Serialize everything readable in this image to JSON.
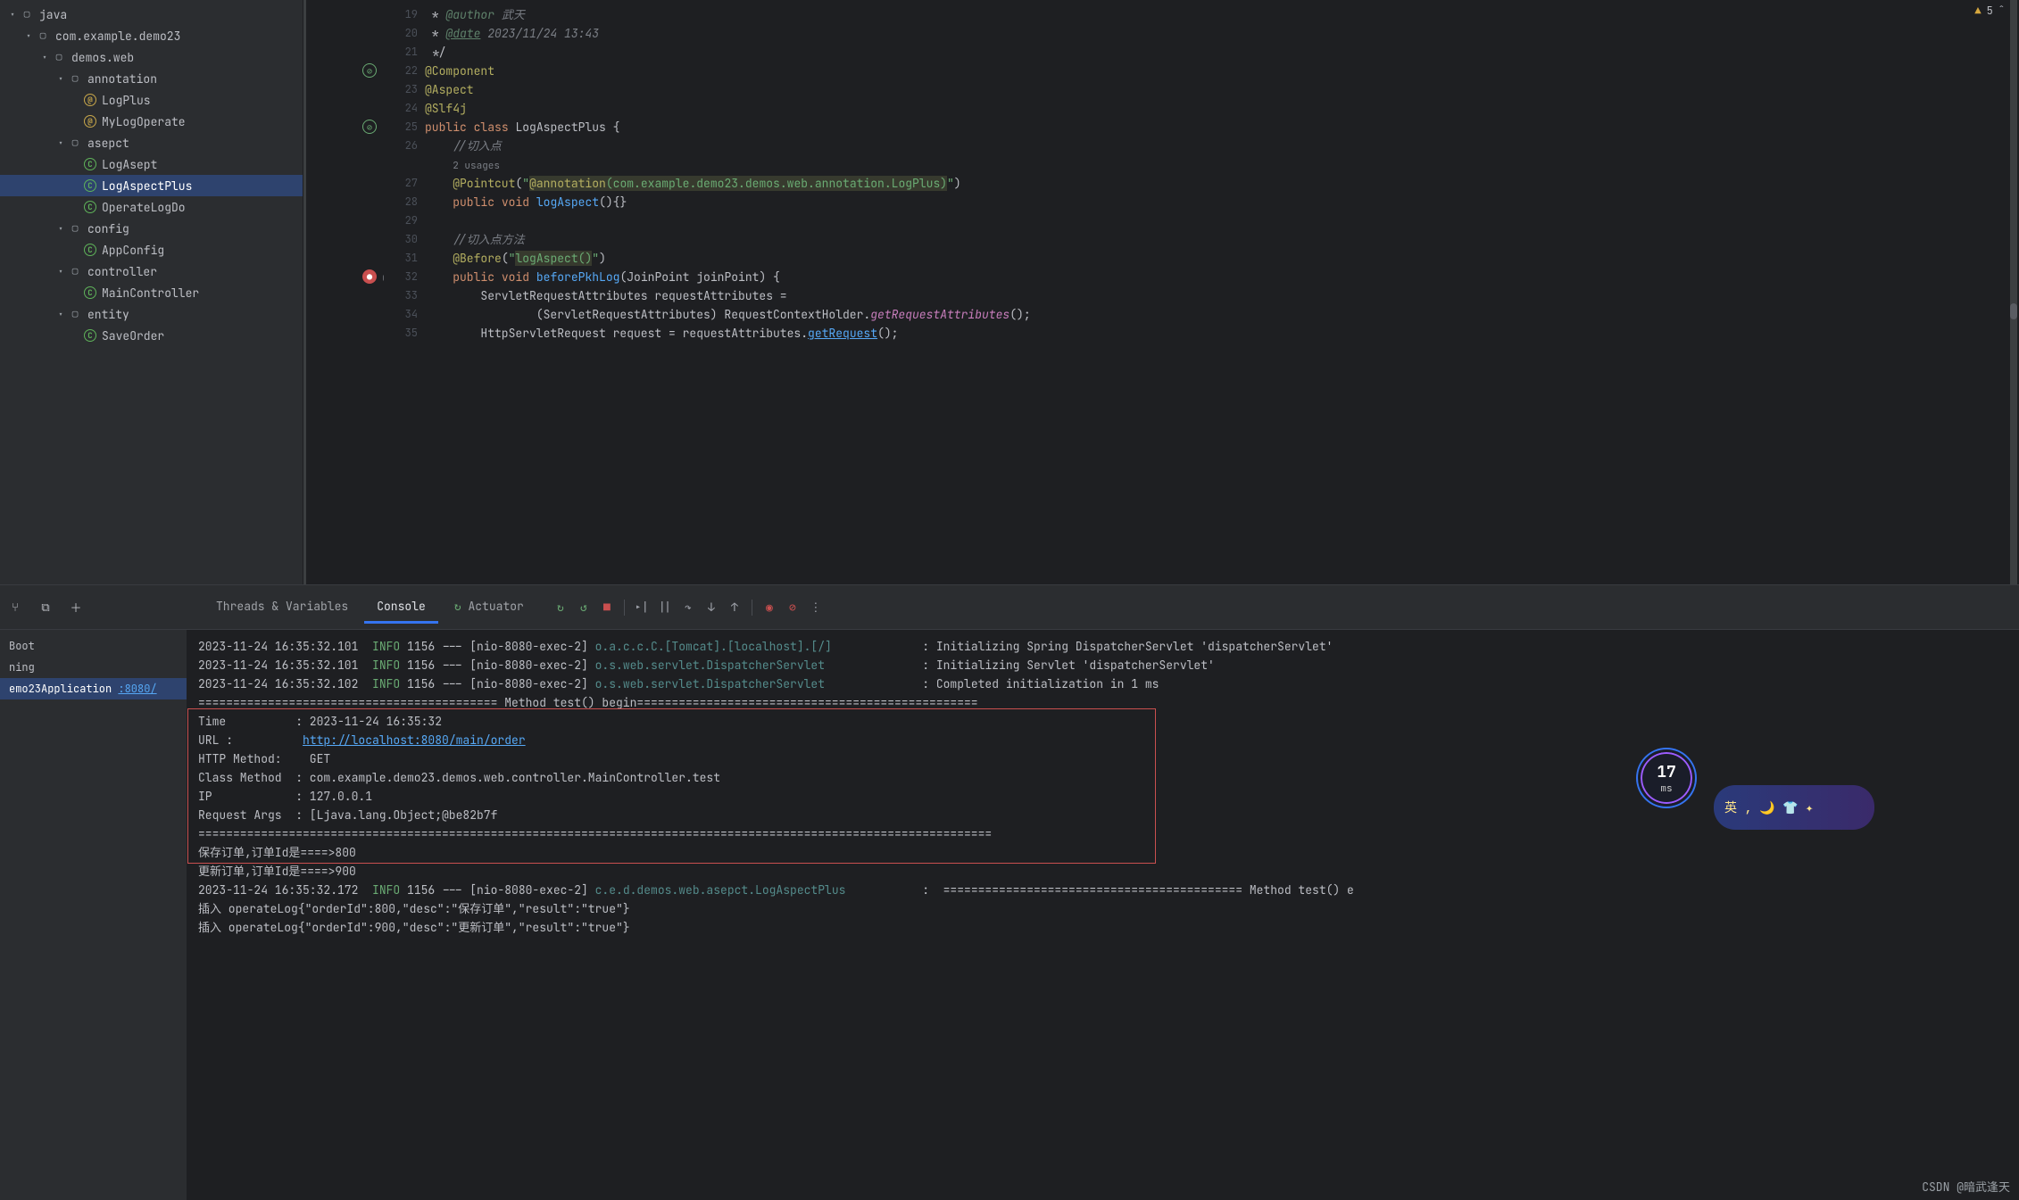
{
  "inspection": {
    "warn_count": "5"
  },
  "tree": [
    {
      "d": 0,
      "tw": "▾",
      "ic": "dir",
      "label": "java"
    },
    {
      "d": 1,
      "tw": "▾",
      "ic": "dir",
      "label": "com.example.demo23"
    },
    {
      "d": 2,
      "tw": "▾",
      "ic": "dir",
      "label": "demos.web"
    },
    {
      "d": 3,
      "tw": "▾",
      "ic": "dir",
      "label": "annotation"
    },
    {
      "d": 4,
      "tw": "",
      "ic": "ann",
      "label": "LogPlus"
    },
    {
      "d": 4,
      "tw": "",
      "ic": "ann",
      "label": "MyLogOperate"
    },
    {
      "d": 3,
      "tw": "▾",
      "ic": "dir",
      "label": "asepct"
    },
    {
      "d": 4,
      "tw": "",
      "ic": "cls",
      "label": "LogAsept"
    },
    {
      "d": 4,
      "tw": "",
      "ic": "cls",
      "label": "LogAspectPlus",
      "sel": true
    },
    {
      "d": 4,
      "tw": "",
      "ic": "cls",
      "label": "OperateLogDo"
    },
    {
      "d": 3,
      "tw": "▾",
      "ic": "dir",
      "label": "config"
    },
    {
      "d": 4,
      "tw": "",
      "ic": "cls",
      "label": "AppConfig"
    },
    {
      "d": 3,
      "tw": "▾",
      "ic": "dir",
      "label": "controller"
    },
    {
      "d": 4,
      "tw": "",
      "ic": "cls",
      "label": "MainController"
    },
    {
      "d": 3,
      "tw": "▾",
      "ic": "dir",
      "label": "entity"
    },
    {
      "d": 4,
      "tw": "",
      "ic": "cls",
      "label": "SaveOrder"
    }
  ],
  "code": {
    "start": 19,
    "lines": [
      {
        "h": " * <span class='c-doc'>@author</span> <span class='c-com'>武天</span>"
      },
      {
        "h": " * <span class='c-doc c-u'>@date</span> <span class='c-com'>2023/11/24 13:43</span>"
      },
      {
        "h": " */"
      },
      {
        "h": "<span class='c-ann'>@Component</span>",
        "gut": "green-strike"
      },
      {
        "h": "<span class='c-ann'>@Aspect</span>"
      },
      {
        "h": "<span class='c-ann'>@Slf4j</span>"
      },
      {
        "h": "<span class='c-kw'>public</span> <span class='c-kw'>class</span> <span class='c-cls'>LogAspectPlus</span> {",
        "gut": "green-strike2"
      },
      {
        "h": "    <span class='c-com'>//切入点</span>"
      },
      {
        "h": "    <span class='c-com' style='font-style:normal;color:#7a7e85;font-size:11px'>2 usages</span>",
        "noline": true
      },
      {
        "h": "    <span class='c-ann'>@Pointcut</span>(<span class='c-str'>\"</span><span class='c-ann c-hl'>@annotation</span><span class='c-str c-hl'>(com.example.demo23.demos.web.annotation.LogPlus)</span><span class='c-str'>\"</span>)"
      },
      {
        "h": "    <span class='c-kw'>public</span> <span class='c-kw'>void</span> <span class='c-mth'>logAspect</span>(){}"
      },
      {
        "h": ""
      },
      {
        "h": "    <span class='c-com'>//切入点方法</span>"
      },
      {
        "h": "    <span class='c-ann'>@Before</span>(<span class='c-str'>\"</span><span class='c-str c-hl'>logAspect()</span><span class='c-str'>\"</span>)"
      },
      {
        "h": "    <span class='c-kw'>public</span> <span class='c-kw'>void</span> <span class='c-mth'>beforePkhLog</span>(JoinPoint joinPoint) {",
        "gut": "bp-at"
      },
      {
        "h": "        ServletRequestAttributes requestAttributes ="
      },
      {
        "h": "                (ServletRequestAttributes) RequestContextHolder.<span class='c-fld'>getRequestAttributes</span>();"
      },
      {
        "h": "        HttpServletRequest request = requestAttributes.<span class='c-mth c-u'>getRequest</span>();"
      }
    ]
  },
  "tool": {
    "tabs": [
      "Threads & Variables",
      "Console",
      "Actuator"
    ],
    "active": 1,
    "actuator_icon": "↻"
  },
  "run_side": {
    "items": [
      "Boot",
      "ning"
    ],
    "sel": {
      "label": "emo23Application",
      "port": ":8080/"
    }
  },
  "console_lines": [
    {
      "ts": "2023-11-24 16:35:32.101",
      "lvl": "INFO",
      "pid": "1156",
      "th": "[nio-8080-exec-2]",
      "logger": "o.a.c.c.C.[Tomcat].[localhost].[/]",
      "msg": ": Initializing Spring DispatcherServlet 'dispatcherServlet'"
    },
    {
      "ts": "2023-11-24 16:35:32.101",
      "lvl": "INFO",
      "pid": "1156",
      "th": "[nio-8080-exec-2]",
      "logger": "o.s.web.servlet.DispatcherServlet",
      "msg": ": Initializing Servlet 'dispatcherServlet'"
    },
    {
      "ts": "2023-11-24 16:35:32.102",
      "lvl": "INFO",
      "pid": "1156",
      "th": "[nio-8080-exec-2]",
      "logger": "o.s.web.servlet.DispatcherServlet",
      "msg": ": Completed initialization in 1 ms"
    }
  ],
  "method_sep": "=========================================== Method test() begin=================================================",
  "boxed": [
    "Time          : 2023-11-24 16:35:32",
    {
      "pre": "URL :          ",
      "url": "http://localhost:8080/main/order"
    },
    "HTTP Method:    GET",
    "Class Method  : com.example.demo23.demos.web.controller.MainController.test",
    "IP            : 127.0.0.1",
    "Request Args  : [Ljava.lang.Object;@be82b7f"
  ],
  "sep_end": "==================================================================================================================",
  "after_box": [
    "保存订单,订单Id是====>800",
    "更新订单,订单Id是====>900"
  ],
  "log_after": {
    "ts": "2023-11-24 16:35:32.172",
    "lvl": "INFO",
    "pid": "1156",
    "th": "[nio-8080-exec-2]",
    "logger": "c.e.d.demos.web.asepct.LogAspectPlus",
    "msg": ":  =========================================== Method test() e"
  },
  "inserts": [
    "插入 operateLog{\"orderId\":800,\"desc\":\"保存订单\",\"result\":\"true\"}",
    "插入 operateLog{\"orderId\":900,\"desc\":\"更新订单\",\"result\":\"true\"}"
  ],
  "timer": {
    "value": "17",
    "unit": "ms"
  },
  "widget_text": "英 , 🌙 👕 ✦",
  "watermark": "CSDN @暗武逢天"
}
